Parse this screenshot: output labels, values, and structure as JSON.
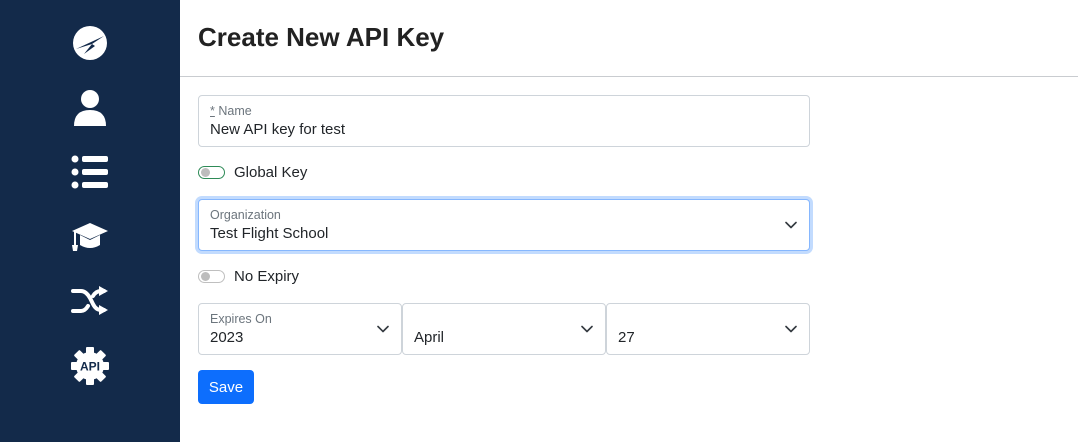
{
  "sidebar": {
    "items": [
      {
        "icon": "logo-compass-icon"
      },
      {
        "icon": "user-icon"
      },
      {
        "icon": "list-icon"
      },
      {
        "icon": "graduation-cap-icon"
      },
      {
        "icon": "shuffle-icon"
      },
      {
        "icon": "api-gear-icon",
        "label": "API"
      }
    ],
    "bg_color": "#132a4a"
  },
  "header": {
    "title": "Create New API Key"
  },
  "form": {
    "name": {
      "required_mark": "*",
      "label": "Name",
      "value": "New API key for test"
    },
    "global_key": {
      "label": "Global Key",
      "checked": false
    },
    "organization": {
      "label": "Organization",
      "value": "Test Flight School"
    },
    "no_expiry": {
      "label": "No Expiry",
      "checked": false
    },
    "expires_on": {
      "label": "Expires On",
      "year": "2023",
      "month": "April",
      "day": "27"
    },
    "save_label": "Save"
  },
  "colors": {
    "accent": "#0d6efd",
    "focus_ring": "#86b7fe"
  }
}
